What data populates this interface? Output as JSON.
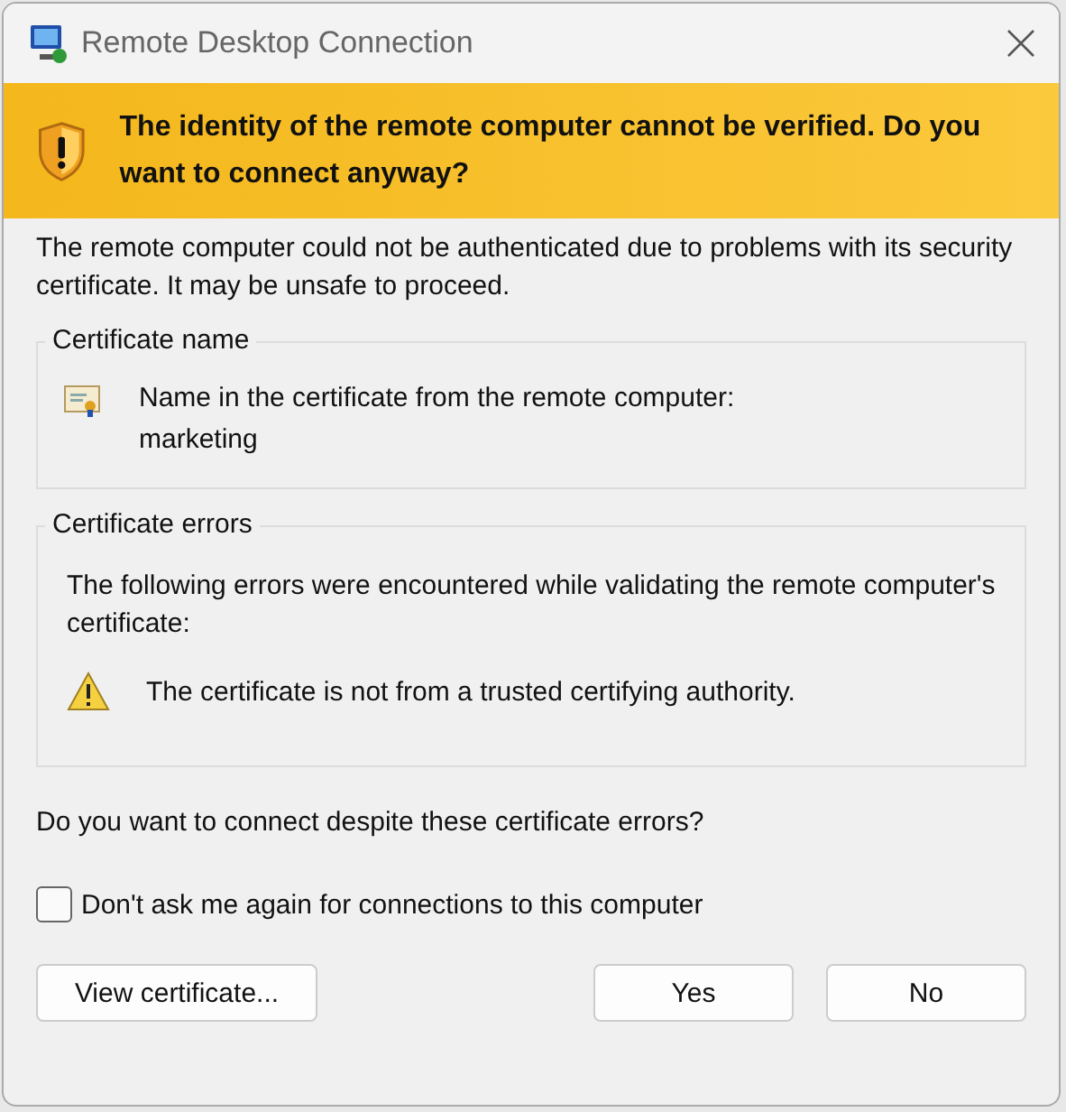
{
  "window": {
    "title": "Remote Desktop Connection"
  },
  "banner": {
    "text": "The identity of the remote computer cannot be verified. Do you want to connect anyway?"
  },
  "intro": "The remote computer could not be authenticated due to problems with its security certificate. It may be unsafe to proceed.",
  "certificate_name": {
    "title": "Certificate name",
    "label": "Name in the certificate from the remote computer:",
    "value": "marketing"
  },
  "certificate_errors": {
    "title": "Certificate errors",
    "intro": "The following errors were encountered while validating the remote computer's certificate:",
    "errors": [
      "The certificate is not from a trusted certifying authority."
    ]
  },
  "question": "Do you want to connect despite these certificate errors?",
  "dont_ask": {
    "label": "Don't ask me again for connections to this computer",
    "checked": false
  },
  "buttons": {
    "view": "View certificate...",
    "yes": "Yes",
    "no": "No"
  }
}
